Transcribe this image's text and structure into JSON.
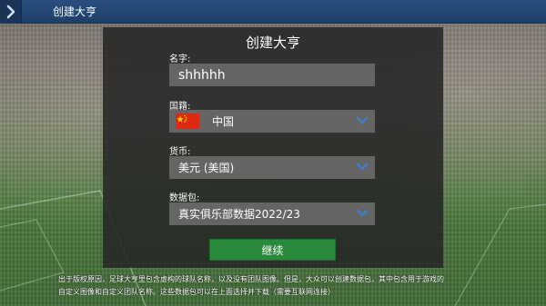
{
  "topbar": {
    "title": "创建大亨"
  },
  "dialog": {
    "title": "创建大亨",
    "name_label": "名字:",
    "name_value": "shhhhh",
    "nationality_label": "国籍:",
    "nationality_value": "中国",
    "nationality_flag": "china-flag",
    "currency_label": "货币:",
    "currency_value": "美元 (美国)",
    "data_pack_label": "数据包:",
    "data_pack_value": "真实俱乐部数据2022/23",
    "continue_label": "继续"
  },
  "note": {
    "line1": "出于版权原因，足球大亨里包含虚构的球队名称，以及没有团队图像。但是，大众可以创建数据包，其中包含用于游戏的",
    "line2": "自定义图像和自定义团队名称。这些数据包可以在上面选择并下载（需要互联网连接）"
  },
  "colors": {
    "topbar": "#1f3f69",
    "accent_chevron": "#3f7fd8",
    "continue_button": "#2a8a3c",
    "dialog_bg": "#262626",
    "field_bg": "#6e6e6e"
  }
}
